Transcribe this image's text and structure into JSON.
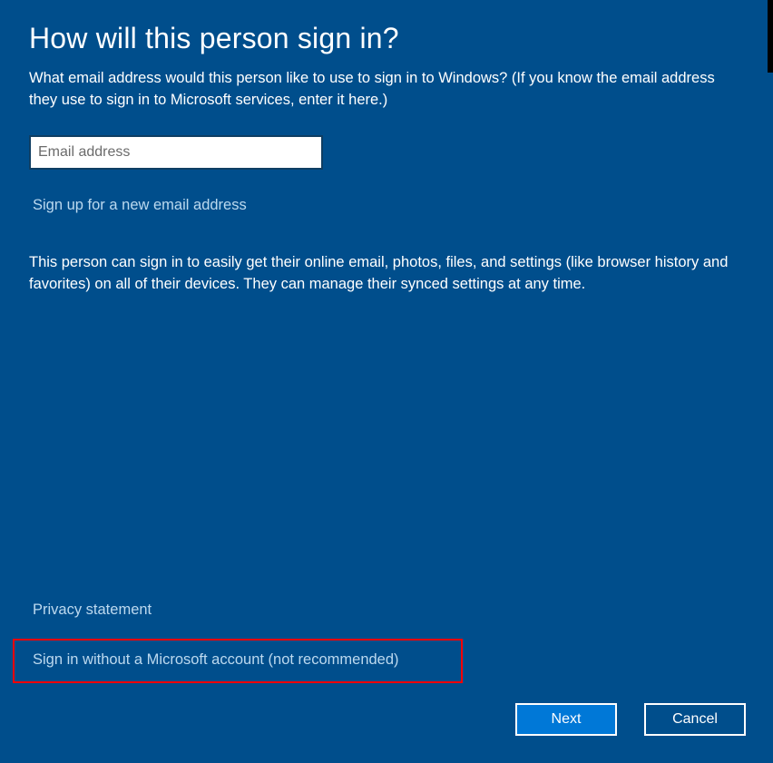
{
  "heading": "How will this person sign in?",
  "subtext": "What email address would this person like to use to sign in to Windows? (If you know the email address they use to sign in to Microsoft services, enter it here.)",
  "email": {
    "placeholder": "Email address",
    "value": ""
  },
  "signup_link": "Sign up for a new email address",
  "info_text": "This person can sign in to easily get their online email, photos, files, and settings (like browser history and favorites) on all of their devices. They can manage their synced settings at any time.",
  "privacy_link": "Privacy statement",
  "no_account_link": "Sign in without a Microsoft account (not recommended)",
  "buttons": {
    "next": "Next",
    "cancel": "Cancel"
  }
}
